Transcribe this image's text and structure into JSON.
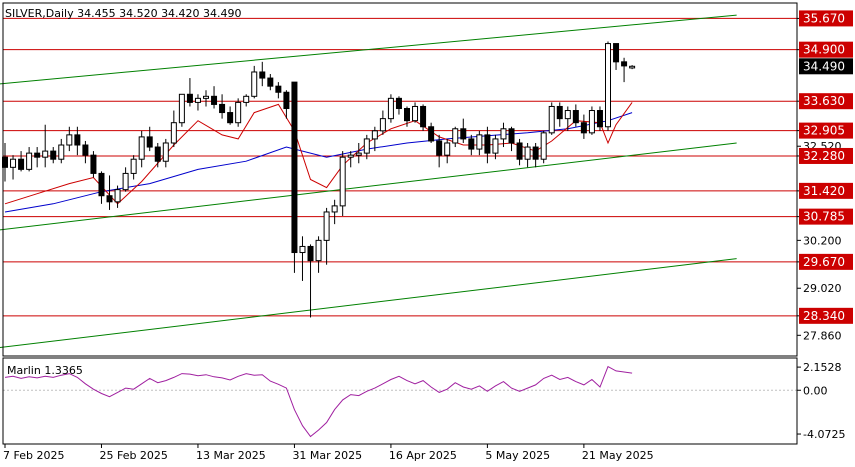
{
  "chart_data": [
    {
      "type": "candlestick",
      "header": "SILVER,Daily  34.455 34.520 34.420 34.490",
      "timeframe": "Daily",
      "symbol": "SILVER",
      "last_price": 34.49,
      "last_price_label": "34.490",
      "ylim": [
        27.35,
        36.05
      ],
      "y_ticks": [
        {
          "value": 35.67,
          "label": "35.670",
          "level": true
        },
        {
          "value": 34.9,
          "label": "34.900",
          "level": true
        },
        {
          "value": 33.63,
          "label": "33.630",
          "level": true
        },
        {
          "value": 32.905,
          "label": "32.905",
          "level": true
        },
        {
          "value": 32.52,
          "label": "32.520",
          "level": false
        },
        {
          "value": 32.28,
          "label": "32.280",
          "level": true
        },
        {
          "value": 31.42,
          "label": "31.420",
          "level": true
        },
        {
          "value": 30.785,
          "label": "30.785",
          "level": true
        },
        {
          "value": 30.2,
          "label": "30.200",
          "level": false
        },
        {
          "value": 29.67,
          "label": "29.670",
          "level": true
        },
        {
          "value": 29.02,
          "label": "29.020",
          "level": false
        },
        {
          "value": 28.34,
          "label": "28.340",
          "level": true
        },
        {
          "value": 27.86,
          "label": "27.860",
          "level": false
        }
      ],
      "x_labels": [
        {
          "index": 0,
          "label": "7 Feb 2025"
        },
        {
          "index": 12,
          "label": "25 Feb 2025"
        },
        {
          "index": 24,
          "label": "13 Mar 2025"
        },
        {
          "index": 36,
          "label": "31 Mar 2025"
        },
        {
          "index": 48,
          "label": "16 Apr 2025"
        },
        {
          "index": 60,
          "label": "5 May 2025"
        },
        {
          "index": 72,
          "label": "21 May 2025"
        }
      ],
      "candles": [
        [
          32.25,
          32.6,
          31.65,
          32.0
        ],
        [
          32.0,
          32.3,
          31.7,
          32.2
        ],
        [
          32.2,
          32.4,
          31.9,
          31.95
        ],
        [
          31.95,
          32.5,
          31.9,
          32.35
        ],
        [
          32.35,
          32.5,
          32.0,
          32.25
        ],
        [
          32.25,
          33.05,
          32.0,
          32.4
        ],
        [
          32.4,
          32.5,
          32.1,
          32.2
        ],
        [
          32.2,
          32.7,
          32.1,
          32.55
        ],
        [
          32.55,
          33.0,
          32.4,
          32.8
        ],
        [
          32.8,
          33.0,
          32.3,
          32.55
        ],
        [
          32.55,
          32.65,
          32.1,
          32.3
        ],
        [
          32.3,
          32.4,
          31.75,
          31.85
        ],
        [
          31.85,
          31.9,
          31.1,
          31.3
        ],
        [
          31.3,
          31.8,
          30.95,
          31.15
        ],
        [
          31.15,
          31.55,
          31.0,
          31.45
        ],
        [
          31.45,
          32.0,
          31.4,
          31.85
        ],
        [
          31.85,
          32.3,
          31.7,
          32.2
        ],
        [
          32.2,
          32.9,
          32.0,
          32.75
        ],
        [
          32.75,
          33.0,
          32.4,
          32.5
        ],
        [
          32.5,
          32.6,
          32.0,
          32.15
        ],
        [
          32.15,
          32.7,
          32.0,
          32.6
        ],
        [
          32.6,
          33.4,
          32.5,
          33.1
        ],
        [
          33.1,
          33.8,
          33.0,
          33.8
        ],
        [
          33.8,
          34.2,
          33.5,
          33.6
        ],
        [
          33.6,
          33.8,
          33.4,
          33.7
        ],
        [
          33.7,
          33.9,
          33.5,
          33.75
        ],
        [
          33.75,
          34.0,
          33.45,
          33.55
        ],
        [
          33.55,
          33.8,
          33.2,
          33.35
        ],
        [
          33.35,
          33.5,
          33.05,
          33.1
        ],
        [
          33.1,
          33.7,
          33.0,
          33.6
        ],
        [
          33.6,
          33.8,
          33.5,
          33.75
        ],
        [
          33.75,
          34.5,
          33.7,
          34.35
        ],
        [
          34.35,
          34.6,
          34.0,
          34.2
        ],
        [
          34.2,
          34.3,
          33.9,
          34.0
        ],
        [
          34.0,
          34.1,
          33.7,
          33.85
        ],
        [
          33.85,
          33.9,
          33.2,
          33.45
        ],
        [
          34.1,
          34.1,
          29.4,
          29.9
        ],
        [
          29.9,
          30.3,
          29.2,
          30.05
        ],
        [
          30.05,
          30.1,
          28.3,
          29.7
        ],
        [
          29.7,
          30.3,
          29.4,
          30.2
        ],
        [
          30.2,
          31.0,
          29.6,
          30.9
        ],
        [
          30.9,
          31.2,
          30.6,
          31.05
        ],
        [
          31.05,
          32.4,
          30.8,
          32.25
        ],
        [
          32.25,
          32.4,
          32.0,
          32.3
        ],
        [
          32.3,
          32.6,
          32.1,
          32.35
        ],
        [
          32.35,
          32.8,
          32.2,
          32.7
        ],
        [
          32.7,
          33.0,
          32.4,
          32.9
        ],
        [
          32.9,
          33.4,
          32.8,
          33.2
        ],
        [
          33.2,
          33.8,
          33.1,
          33.7
        ],
        [
          33.7,
          33.75,
          33.3,
          33.45
        ],
        [
          33.45,
          33.5,
          33.0,
          33.15
        ],
        [
          33.15,
          33.6,
          33.1,
          33.5
        ],
        [
          33.5,
          33.55,
          32.9,
          33.0
        ],
        [
          33.0,
          33.1,
          32.6,
          32.65
        ],
        [
          32.65,
          32.8,
          32.0,
          32.3
        ],
        [
          32.3,
          32.7,
          32.1,
          32.6
        ],
        [
          32.6,
          33.0,
          32.5,
          32.95
        ],
        [
          32.95,
          33.2,
          32.6,
          32.7
        ],
        [
          32.7,
          32.8,
          32.3,
          32.45
        ],
        [
          32.45,
          32.9,
          32.3,
          32.8
        ],
        [
          32.8,
          33.0,
          32.1,
          32.35
        ],
        [
          32.35,
          32.8,
          32.2,
          32.7
        ],
        [
          32.7,
          33.1,
          32.5,
          32.95
        ],
        [
          32.95,
          33.0,
          32.4,
          32.6
        ],
        [
          32.6,
          32.7,
          32.05,
          32.2
        ],
        [
          32.2,
          32.6,
          32.0,
          32.5
        ],
        [
          32.5,
          32.6,
          32.0,
          32.2
        ],
        [
          32.2,
          32.9,
          32.1,
          32.85
        ],
        [
          32.85,
          33.6,
          32.8,
          33.5
        ],
        [
          33.5,
          33.6,
          33.0,
          33.2
        ],
        [
          33.2,
          33.5,
          32.9,
          33.4
        ],
        [
          33.4,
          33.55,
          33.0,
          33.1
        ],
        [
          33.1,
          33.3,
          32.7,
          32.85
        ],
        [
          32.85,
          33.5,
          32.8,
          33.4
        ],
        [
          33.4,
          33.5,
          32.9,
          33.0
        ],
        [
          33.0,
          35.1,
          32.9,
          35.05
        ],
        [
          35.05,
          35.05,
          34.4,
          34.6
        ],
        [
          34.6,
          34.7,
          34.1,
          34.5
        ],
        [
          34.45,
          34.52,
          34.42,
          34.49
        ]
      ],
      "series": [
        {
          "name": "",
          "color": "#0000cc",
          "role": "slow moving average",
          "points": [
            [
              0,
              30.9
            ],
            [
              6,
              31.1
            ],
            [
              12,
              31.4
            ],
            [
              18,
              31.6
            ],
            [
              24,
              31.95
            ],
            [
              30,
              32.15
            ],
            [
              35,
              32.5
            ],
            [
              40,
              32.25
            ],
            [
              45,
              32.45
            ],
            [
              50,
              32.6
            ],
            [
              55,
              32.7
            ],
            [
              60,
              32.78
            ],
            [
              65,
              32.85
            ],
            [
              70,
              32.95
            ],
            [
              75,
              33.15
            ],
            [
              78,
              33.35
            ]
          ]
        },
        {
          "name": "",
          "color": "#cc0000",
          "role": "fast moving average",
          "points": [
            [
              0,
              31.1
            ],
            [
              4,
              31.35
            ],
            [
              8,
              31.6
            ],
            [
              11,
              31.75
            ],
            [
              14,
              31.1
            ],
            [
              17,
              31.65
            ],
            [
              21,
              32.55
            ],
            [
              24,
              33.15
            ],
            [
              27,
              32.8
            ],
            [
              29,
              32.7
            ],
            [
              31,
              33.35
            ],
            [
              34,
              33.55
            ],
            [
              36,
              32.9
            ],
            [
              38,
              31.7
            ],
            [
              40,
              31.5
            ],
            [
              42,
              32.05
            ],
            [
              45,
              32.6
            ],
            [
              48,
              32.95
            ],
            [
              51,
              33.15
            ],
            [
              54,
              32.75
            ],
            [
              57,
              32.55
            ],
            [
              60,
              32.55
            ],
            [
              63,
              32.6
            ],
            [
              66,
              32.4
            ],
            [
              68,
              32.65
            ],
            [
              71,
              33.15
            ],
            [
              74,
              33.1
            ],
            [
              75,
              32.6
            ],
            [
              76,
              33.05
            ],
            [
              78,
              33.6
            ]
          ]
        }
      ],
      "lines": [
        {
          "name": "",
          "color": "#008000",
          "points": [
            [
              -1,
              34.05
            ],
            [
              91,
              35.75
            ]
          ]
        },
        {
          "name": "",
          "color": "#008000",
          "points": [
            [
              -1,
              30.45
            ],
            [
              91,
              32.6
            ]
          ]
        },
        {
          "name": "",
          "color": "#008000",
          "points": [
            [
              -1,
              27.55
            ],
            [
              91,
              29.75
            ]
          ]
        }
      ],
      "horizontal_levels_color": "#cc0000",
      "grid": false
    },
    {
      "type": "line",
      "label": "Marlin 1.3365",
      "color": "#a020a0",
      "ylim": [
        -5.0,
        3.0
      ],
      "y_ticks": [
        {
          "value": 2.1528,
          "label": "2.1528"
        },
        {
          "value": 0.0,
          "label": "0.00"
        },
        {
          "value": -4.0725,
          "label": "-4.0725"
        }
      ],
      "values": [
        1.2,
        1.3,
        1.1,
        1.25,
        1.15,
        1.3,
        1.2,
        1.4,
        1.55,
        1.2,
        0.6,
        0.1,
        -0.3,
        -0.6,
        -0.2,
        0.2,
        0.1,
        0.6,
        1.1,
        0.7,
        0.9,
        1.2,
        1.55,
        1.5,
        1.35,
        1.45,
        1.25,
        1.15,
        0.95,
        1.3,
        1.55,
        1.4,
        1.45,
        0.85,
        0.55,
        0.2,
        -1.8,
        -3.3,
        -4.3,
        -3.7,
        -3.0,
        -1.8,
        -0.9,
        -0.4,
        -0.5,
        -0.1,
        0.2,
        0.6,
        1.0,
        1.3,
        0.9,
        0.6,
        0.9,
        0.3,
        -0.2,
        0.1,
        0.7,
        0.3,
        0.1,
        0.4,
        -0.1,
        0.4,
        0.8,
        0.2,
        -0.1,
        0.2,
        0.5,
        1.1,
        1.4,
        1.0,
        1.2,
        0.8,
        0.5,
        1.0,
        0.3,
        2.2,
        1.8,
        1.7,
        1.6
      ]
    }
  ]
}
